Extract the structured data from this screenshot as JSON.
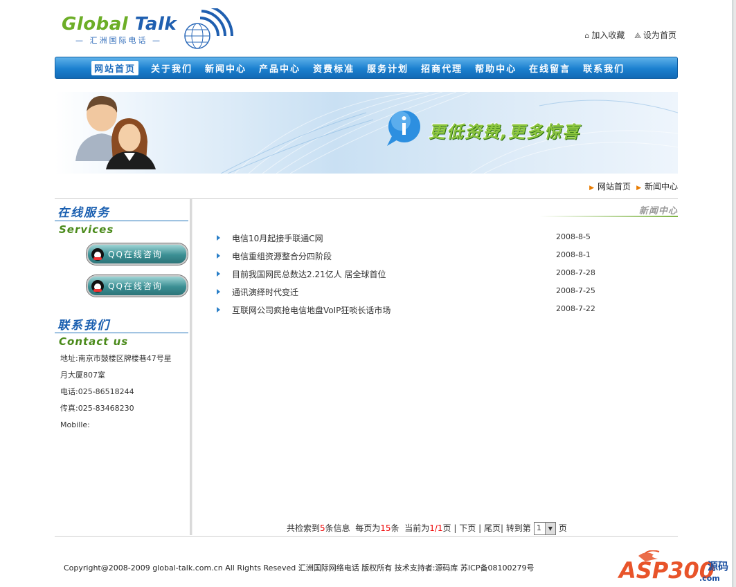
{
  "header": {
    "logo_text_1": "Global",
    "logo_text_2": "Talk",
    "logo_subtitle": "— 汇洲国际电话 —",
    "links": [
      {
        "label": "加入收藏",
        "icon": "house-icon"
      },
      {
        "label": "设为首页",
        "icon": "home-page-icon"
      }
    ]
  },
  "nav": {
    "items": [
      "网站首页",
      "关于我们",
      "新闻中心",
      "产品中心",
      "资费标准",
      "服务计划",
      "招商代理",
      "帮助中心",
      "在线留言",
      "联系我们"
    ],
    "active_index": 0
  },
  "banner": {
    "slogan": "更低资费,更多惊喜"
  },
  "breadcrumb": {
    "items": [
      "网站首页",
      "新闻中心"
    ]
  },
  "sidebar": {
    "services_title": "在线服务",
    "services_en": "Services",
    "qq_buttons": [
      "QQ在线咨询",
      "QQ在线咨询"
    ],
    "contact_title": "联系我们",
    "contact_en": "Contact us",
    "contact_lines": [
      "地址:南京市鼓楼区牌楼巷47号星",
      "月大厦807室",
      "电话:025-86518244",
      "传真:025-83468230",
      "Mobille:"
    ]
  },
  "main": {
    "section_title": "新闻中心",
    "news": [
      {
        "title": "电信10月起接手联通C网",
        "date": "2008-8-5"
      },
      {
        "title": "电信重组资源整合分四阶段",
        "date": "2008-8-1"
      },
      {
        "title": "目前我国网民总数达2.21亿人 居全球首位",
        "date": "2008-7-28"
      },
      {
        "title": "通讯演绎时代变迁",
        "date": "2008-7-25"
      },
      {
        "title": "互联网公司疯抢电信地盘VoIP狂啖长话市场",
        "date": "2008-7-22"
      }
    ]
  },
  "pager": {
    "p1": "共检索到",
    "total": "5",
    "p2": "条信息  每页为",
    "per_page": "15",
    "p3": "条  当前为",
    "current": "1/1",
    "p4": "页 |",
    "next": "下页",
    "sep": "|",
    "last": "尾页",
    "jump": "| 转到第",
    "select_value": "1",
    "page_unit": "页"
  },
  "footer": {
    "copyright": "Copyright@2008-2009 global-talk.com.cn All Rights Reseved 汇洲国际网络电话 版权所有 技术支持者:源码库 苏ICP备08100279号",
    "brand_logo": "ASP300.com 源码",
    "brand_logo_part1": "ASP300",
    "brand_logo_part2": ".com",
    "brand_logo_part3": "源码"
  },
  "colors": {
    "nav_blue": "#1b80cf",
    "title_blue": "#1a5fb0",
    "green": "#4a8a1a",
    "accent_red": "#e00000"
  }
}
